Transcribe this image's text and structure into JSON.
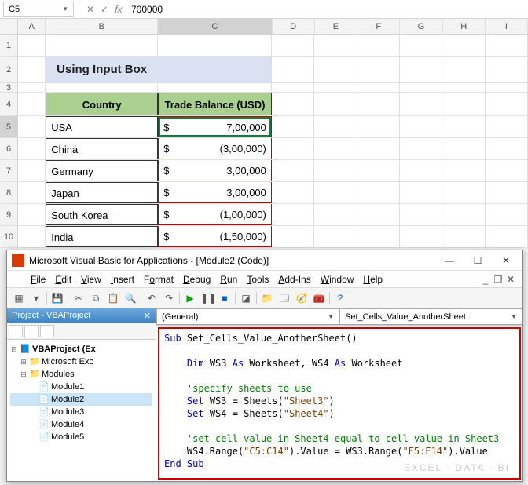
{
  "formula": {
    "name_box": "C5",
    "value": "700000",
    "fx": "fx"
  },
  "cols": [
    "A",
    "B",
    "C",
    "D",
    "E",
    "F",
    "G",
    "H",
    "I"
  ],
  "rownums": [
    "1",
    "2",
    "3",
    "4",
    "5",
    "6",
    "7",
    "8",
    "9",
    "10"
  ],
  "title": "Using Input Box",
  "headers": {
    "b": "Country",
    "c": "Trade Balance (USD)"
  },
  "rows": [
    {
      "country": "USA",
      "cur": "$",
      "val": "7,00,000"
    },
    {
      "country": "China",
      "cur": "$",
      "val": "(3,00,000)"
    },
    {
      "country": "Germany",
      "cur": "$",
      "val": "3,00,000"
    },
    {
      "country": "Japan",
      "cur": "$",
      "val": "3,00,000"
    },
    {
      "country": "South Korea",
      "cur": "$",
      "val": "(1,00,000)"
    },
    {
      "country": "India",
      "cur": "$",
      "val": "(1,50,000)"
    }
  ],
  "vbe": {
    "title": "Microsoft Visual Basic for Applications - [Module2 (Code)]",
    "menu": [
      "File",
      "Edit",
      "View",
      "Insert",
      "Format",
      "Debug",
      "Run",
      "Tools",
      "Add-Ins",
      "Window",
      "Help"
    ],
    "proj_title": "Project - VBAProject",
    "tree": {
      "root": "VBAProject (Ex",
      "objs": "Microsoft Exc",
      "mods": "Modules",
      "items": [
        "Module1",
        "Module2",
        "Module3",
        "Module4",
        "Module5"
      ]
    },
    "combos": {
      "left": "(General)",
      "right": "Set_Cells_Value_AnotherSheet"
    },
    "code": {
      "l1a": "Sub",
      "l1b": " Set_Cells_Value_AnotherSheet()",
      "l2a": "Dim",
      "l2b": " WS3 ",
      "l2c": "As",
      "l2d": " Worksheet, WS4 ",
      "l2e": "As",
      "l2f": " Worksheet",
      "l3": "'specify sheets to use",
      "l4a": "Set",
      "l4b": " WS3 = Sheets(",
      "l4c": "\"Sheet3\"",
      "l4d": ")",
      "l5a": "Set",
      "l5b": " WS4 = Sheets(",
      "l5c": "\"Sheet4\"",
      "l5d": ")",
      "l6": "'set cell value in Sheet4 equal to cell value in Sheet3",
      "l7a": "    WS4.Range(",
      "l7b": "\"C5:C14\"",
      "l7c": ").Value = WS3.Range(",
      "l7d": "\"E5:E14\"",
      "l7e": ").Value",
      "l8": "End Sub"
    },
    "watermark": "EXCEL · DATA · BI"
  }
}
